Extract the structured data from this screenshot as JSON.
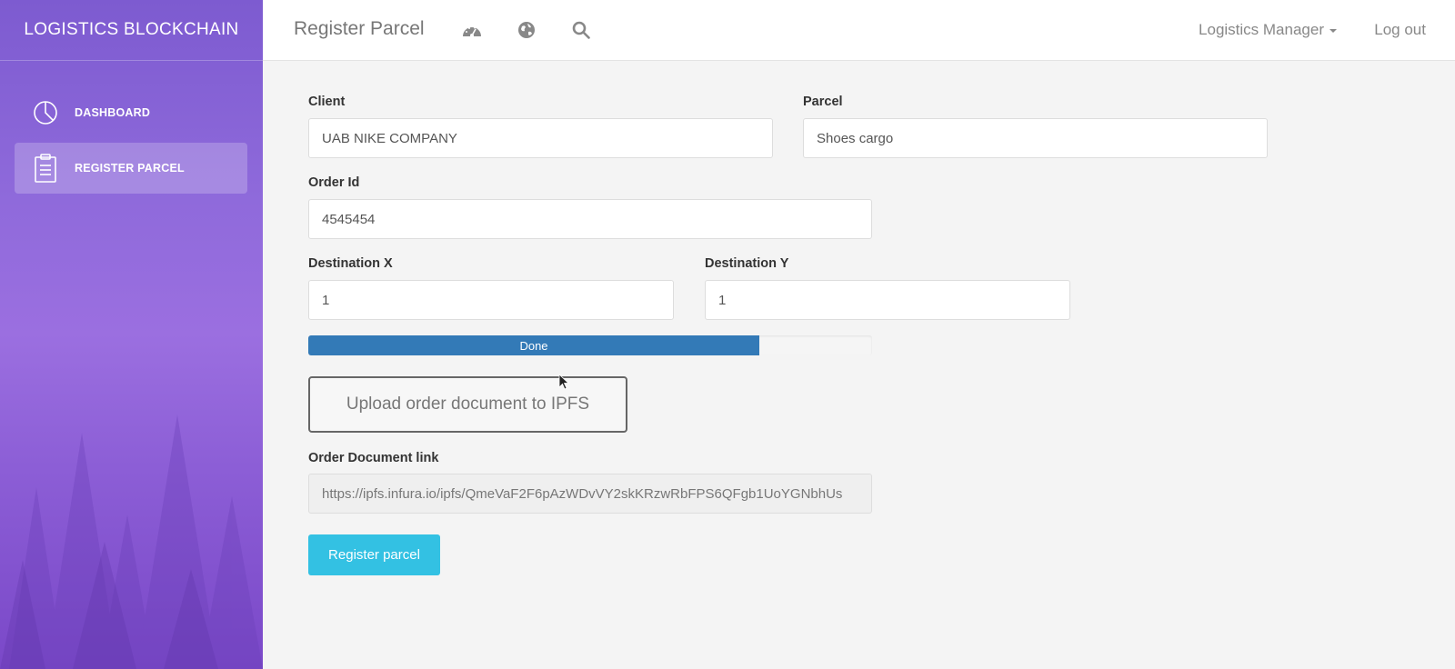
{
  "sidebar": {
    "brand": "LOGISTICS BLOCKCHAIN",
    "items": [
      {
        "label": "DASHBOARD",
        "icon": "pie-chart-icon",
        "active": false
      },
      {
        "label": "REGISTER PARCEL",
        "icon": "clipboard-icon",
        "active": true
      }
    ]
  },
  "header": {
    "title": "Register Parcel",
    "icons": [
      "dashboard-gauge-icon",
      "globe-icon",
      "search-icon"
    ],
    "user": "Logistics Manager",
    "logout": "Log out"
  },
  "form": {
    "client": {
      "label": "Client",
      "value": "UAB NIKE COMPANY"
    },
    "parcel": {
      "label": "Parcel",
      "value": "Shoes cargo"
    },
    "order_id": {
      "label": "Order Id",
      "value": "4545454"
    },
    "destination_x": {
      "label": "Destination X",
      "value": "1"
    },
    "destination_y": {
      "label": "Destination Y",
      "value": "1"
    },
    "progress": {
      "label": "Done",
      "percent": 80
    },
    "upload_button": "Upload order document to IPFS",
    "document_link": {
      "label": "Order Document link",
      "value": "https://ipfs.infura.io/ipfs/QmeVaF2F6pAzWDvVY2skKRzwRbFPS6QFgb1UoYGNbhUs"
    },
    "submit_button": "Register parcel"
  },
  "colors": {
    "sidebar_gradient": [
      "#7d5bd0",
      "#9b6fe0",
      "#7a48c8"
    ],
    "progress": "#337ab7",
    "submit": "#33c1e3"
  }
}
